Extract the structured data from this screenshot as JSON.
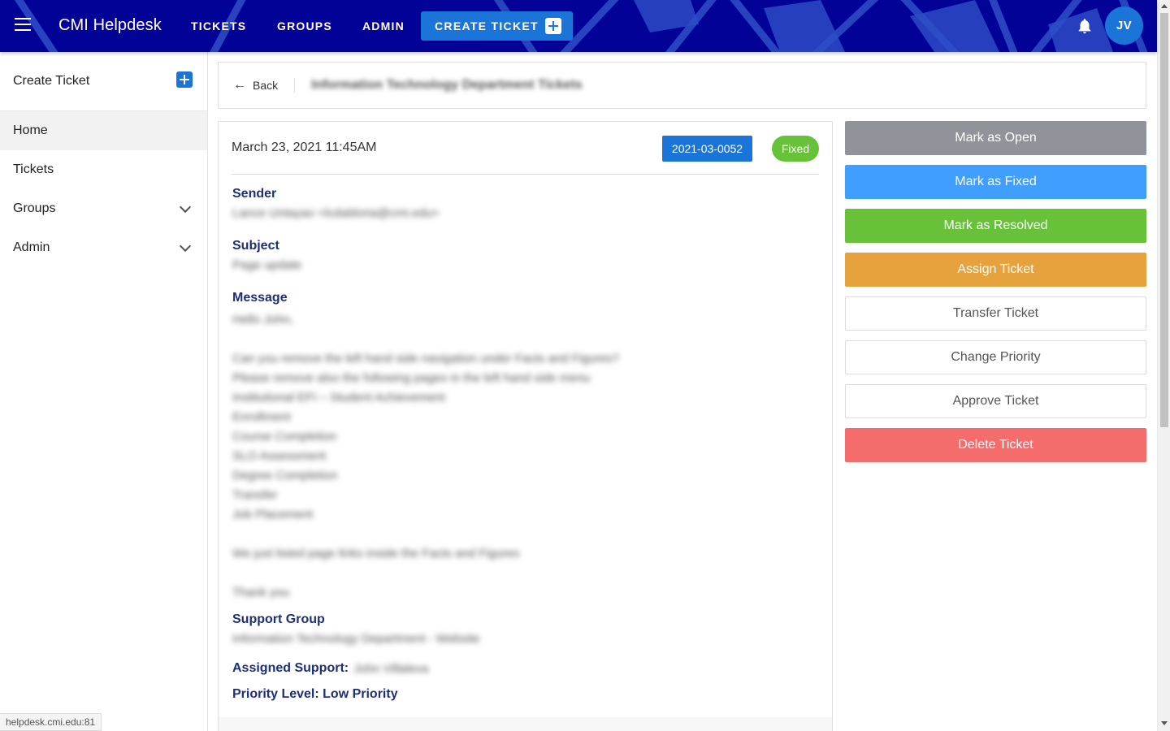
{
  "app": {
    "brand": "CMI Helpdesk",
    "nav": [
      "TICKETS",
      "GROUPS",
      "ADMIN"
    ],
    "create_ticket": "CREATE TICKET",
    "avatar_initials": "JV",
    "icons": {
      "menu": "hamburger-icon",
      "create": "add-comment-icon",
      "notifications": "bell-icon"
    },
    "colors": {
      "topbar": "#1a1aa0",
      "primary": "#1b75d8"
    }
  },
  "sidebar": {
    "create": "Create Ticket",
    "items": [
      {
        "label": "Home",
        "active": true
      },
      {
        "label": "Tickets"
      },
      {
        "label": "Groups",
        "expandable": true
      },
      {
        "label": "Admin",
        "expandable": true
      }
    ]
  },
  "header": {
    "back": "Back",
    "title": "Information Technology Department Tickets"
  },
  "ticket": {
    "date": "March 23, 2021 11:45AM",
    "number": "2021-03-0052",
    "status": "Fixed",
    "sender_label": "Sender",
    "sender_value": "Lance Untayao <lcdaldoria@cmi.edu>",
    "subject_label": "Subject",
    "subject_value": "Page update",
    "message_label": "Message",
    "message_lines": [
      "Hello John,",
      "",
      "Can you remove the left hand side navigation under Facts and Figures?",
      "Please remove also the following pages in the left hand side menu",
      "Institutional EFI – Student Achievement",
      "Enrollment",
      "Course Completion",
      "SLO Assessment",
      "Degree Completion",
      "Transfer",
      "Job Placement",
      "",
      "We just listed page links inside the Facts and Figures",
      "",
      "Thank you"
    ],
    "group_label": "Support Group",
    "group_value": "Information Technology Department - Website",
    "assigned_label": "Assigned Support:",
    "assigned_value": "John Villaleva",
    "priority_text": "Priority Level: Low Priority"
  },
  "actions": [
    {
      "label": "Mark as Open",
      "color": "#909399",
      "style": "solid"
    },
    {
      "label": "Mark as Fixed",
      "color": "#409eff",
      "style": "solid"
    },
    {
      "label": "Mark as Resolved",
      "color": "#67c23a",
      "style": "solid"
    },
    {
      "label": "Assign Ticket",
      "color": "#e6a23c",
      "style": "solid"
    },
    {
      "label": "Transfer Ticket",
      "style": "outline"
    },
    {
      "label": "Change Priority",
      "style": "outline"
    },
    {
      "label": "Approve Ticket",
      "style": "outline"
    },
    {
      "label": "Delete Ticket",
      "color": "#f56c6c",
      "style": "solid"
    }
  ],
  "status_bar": {
    "url": "helpdesk.cmi.edu:81"
  }
}
